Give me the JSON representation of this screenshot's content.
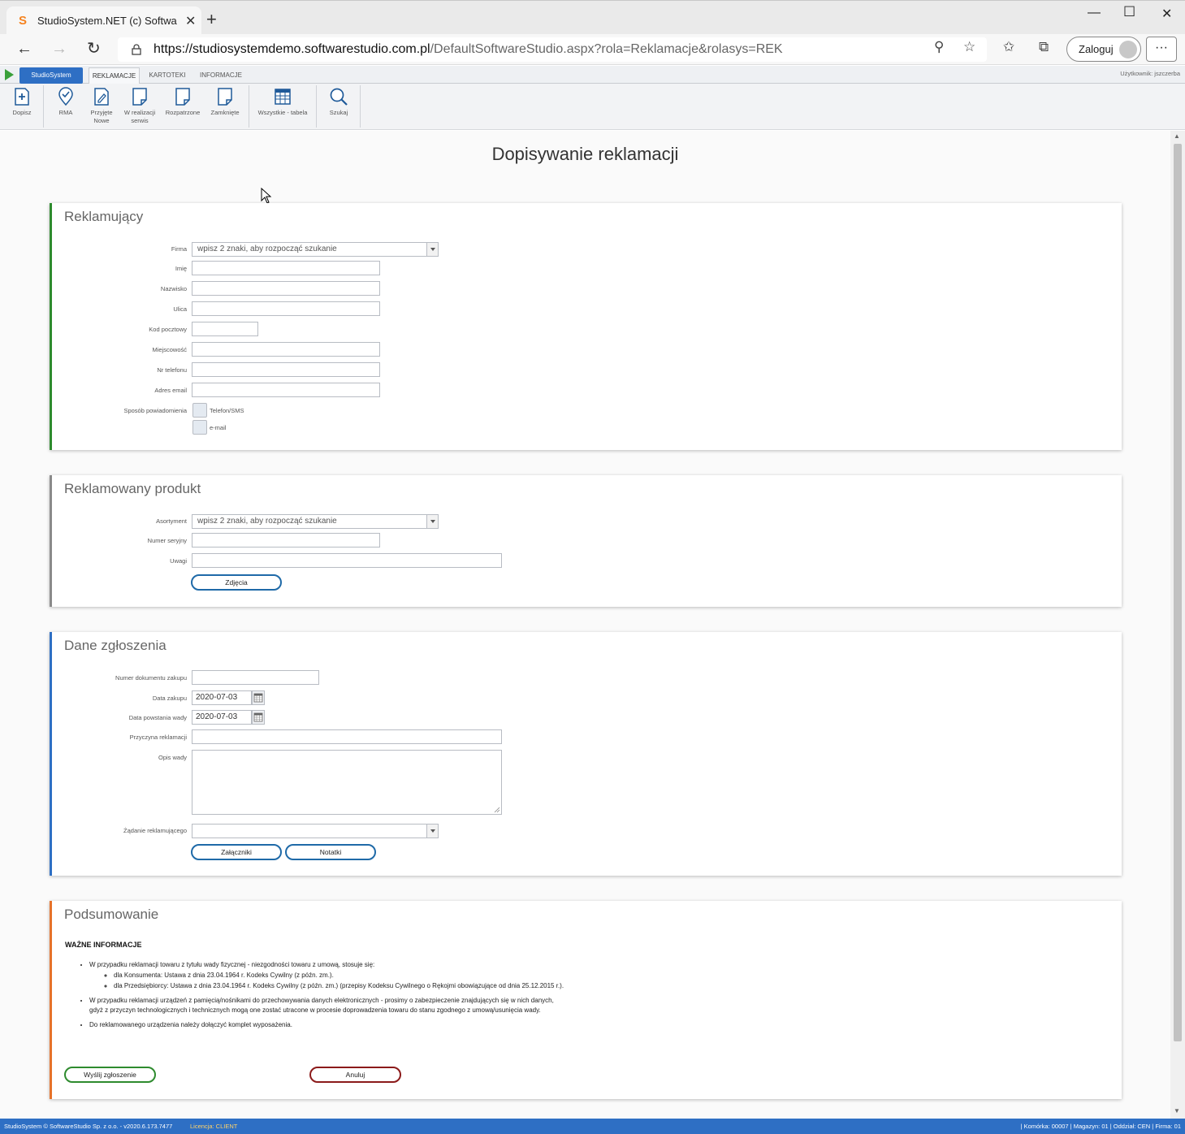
{
  "browser": {
    "tab_title": "StudioSystem.NET (c) SoftwareSt",
    "url_host": "https://studiosystemdemo.softwarestudio.com.pl",
    "url_path": "/DefaultSoftwareStudio.aspx?rola=Reklamacje&rolasys=REK",
    "login_label": "Zaloguj"
  },
  "ribbon": {
    "app_button": "StudioSystem",
    "tabs": [
      "REKLAMACJE",
      "KARTOTEKI",
      "INFORMACJE"
    ],
    "user": "Użytkownik: jszczerba",
    "tools": {
      "dopisz": "Dopisz",
      "rma": "RMA",
      "przyjete": "Przyjęte",
      "przyjete2": "Nowe",
      "wreal": "W realizacji",
      "wreal2": "serwis",
      "rozpatrzone": "Rozpatrzone",
      "zamkniete": "Zamknięte",
      "wszystkie": "Wszystkie - tabela",
      "szukaj": "Szukaj"
    }
  },
  "page": {
    "title": "Dopisywanie reklamacji"
  },
  "reklamujacy": {
    "heading": "Reklamujący",
    "firma_label": "Firma",
    "firma_placeholder": "wpisz 2 znaki, aby rozpocząć szukanie",
    "imie": "Imię",
    "nazwisko": "Nazwisko",
    "ulica": "Ulica",
    "kod": "Kod pocztowy",
    "miejscowosc": "Miejscowość",
    "telefon": "Nr telefonu",
    "email": "Adres email",
    "sposob": "Sposób powiadomienia",
    "opt_sms": "Telefon/SMS",
    "opt_email": "e-mail"
  },
  "produkt": {
    "heading": "Reklamowany produkt",
    "asortyment_label": "Asortyment",
    "asortyment_placeholder": "wpisz 2 znaki, aby rozpocząć szukanie",
    "numer": "Numer seryjny",
    "uwagi": "Uwagi",
    "zdjecia": "Zdjęcia"
  },
  "zgloszenie": {
    "heading": "Dane zgłoszenia",
    "nr_dok": "Numer dokumentu zakupu",
    "data_zakupu": "Data zakupu",
    "data_zakupu_val": "2020-07-03",
    "data_wady": "Data powstania wady",
    "data_wady_val": "2020-07-03",
    "przyczyna": "Przyczyna reklamacji",
    "opis": "Opis wady",
    "zadanie": "Żądanie reklamującego",
    "zalaczniki": "Załączniki",
    "notatki": "Notatki"
  },
  "podsumowanie": {
    "heading": "Podsumowanie",
    "info_title": "WAŻNE INFORMACJE",
    "b1": "W przypadku reklamacji towaru z tytułu wady fizycznej - niezgodności towaru z umową, stosuje się:",
    "b1a": "dla Konsumenta: Ustawa z dnia 23.04.1964 r. Kodeks Cywilny (z późn. zm.).",
    "b1b": "dla Przedsiębiorcy: Ustawa z dnia 23.04.1964 r. Kodeks Cywilny (z późn. zm.) (przepisy Kodeksu Cywilnego o Rękojmi obowiązujące od dnia 25.12.2015 r.).",
    "b2": "W przypadku reklamacji urządzeń z pamięcią/nośnikami do przechowywania danych elektronicznych - prosimy o zabezpieczenie znajdujących się w nich danych, gdyż z przyczyn technologicznych i technicznych mogą one zostać utracone w procesie doprowadzenia towaru do stanu zgodnego z umową/usunięcia wady.",
    "b3": "Do reklamowanego urządzenia należy dołączyć komplet wyposażenia.",
    "send": "Wyślij zgłoszenie",
    "cancel": "Anuluj"
  },
  "status": {
    "left": "StudioSystem © SoftwareStudio Sp. z o.o. - v2020.6.173.7477",
    "licencja": "Licencja: CLIENT",
    "right": "| Komórka: 00007 | Magazyn: 01 | Oddział: CEN | Firma: 01"
  },
  "colors": {
    "green": "#2e8b2e",
    "gray": "#8a8a8a",
    "blue": "#2e6fc4",
    "orange": "#e6722a",
    "accent": "#1f6aa8",
    "cancel": "#8b1a1a"
  }
}
